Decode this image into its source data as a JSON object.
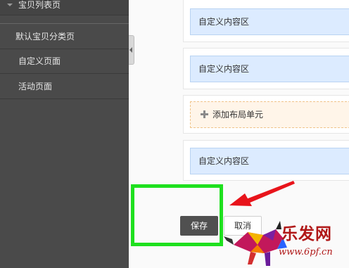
{
  "sidebar": {
    "section_title": "宝贝列表页",
    "items": [
      {
        "label": "默认宝贝分类页"
      },
      {
        "label": "自定义页面"
      },
      {
        "label": "活动页面"
      }
    ]
  },
  "main": {
    "modules": [
      {
        "label": "自定义内容区"
      },
      {
        "label": "自定义内容区"
      },
      {
        "label": "添加布局单元"
      },
      {
        "label": "自定义内容区"
      }
    ]
  },
  "actions": {
    "save_label": "保存",
    "cancel_label": "取消"
  },
  "watermark": {
    "brand": "乐发网",
    "url": "www.6pf.cn"
  },
  "colors": {
    "sidebar_bg": "#4a4a4a",
    "module_bg": "#dcebff",
    "add_unit_bg": "#fff5e9",
    "save_button_bg": "#505050",
    "highlight_box": "#1ee01e",
    "arrow": "#e8141b"
  },
  "icons": {
    "section_caret": "caret-down-icon",
    "collapse_handle": "chevron-left-icon",
    "add_unit": "plus-icon",
    "annotation": "red-arrow-icon",
    "watermark_logo": "bull-logo"
  }
}
